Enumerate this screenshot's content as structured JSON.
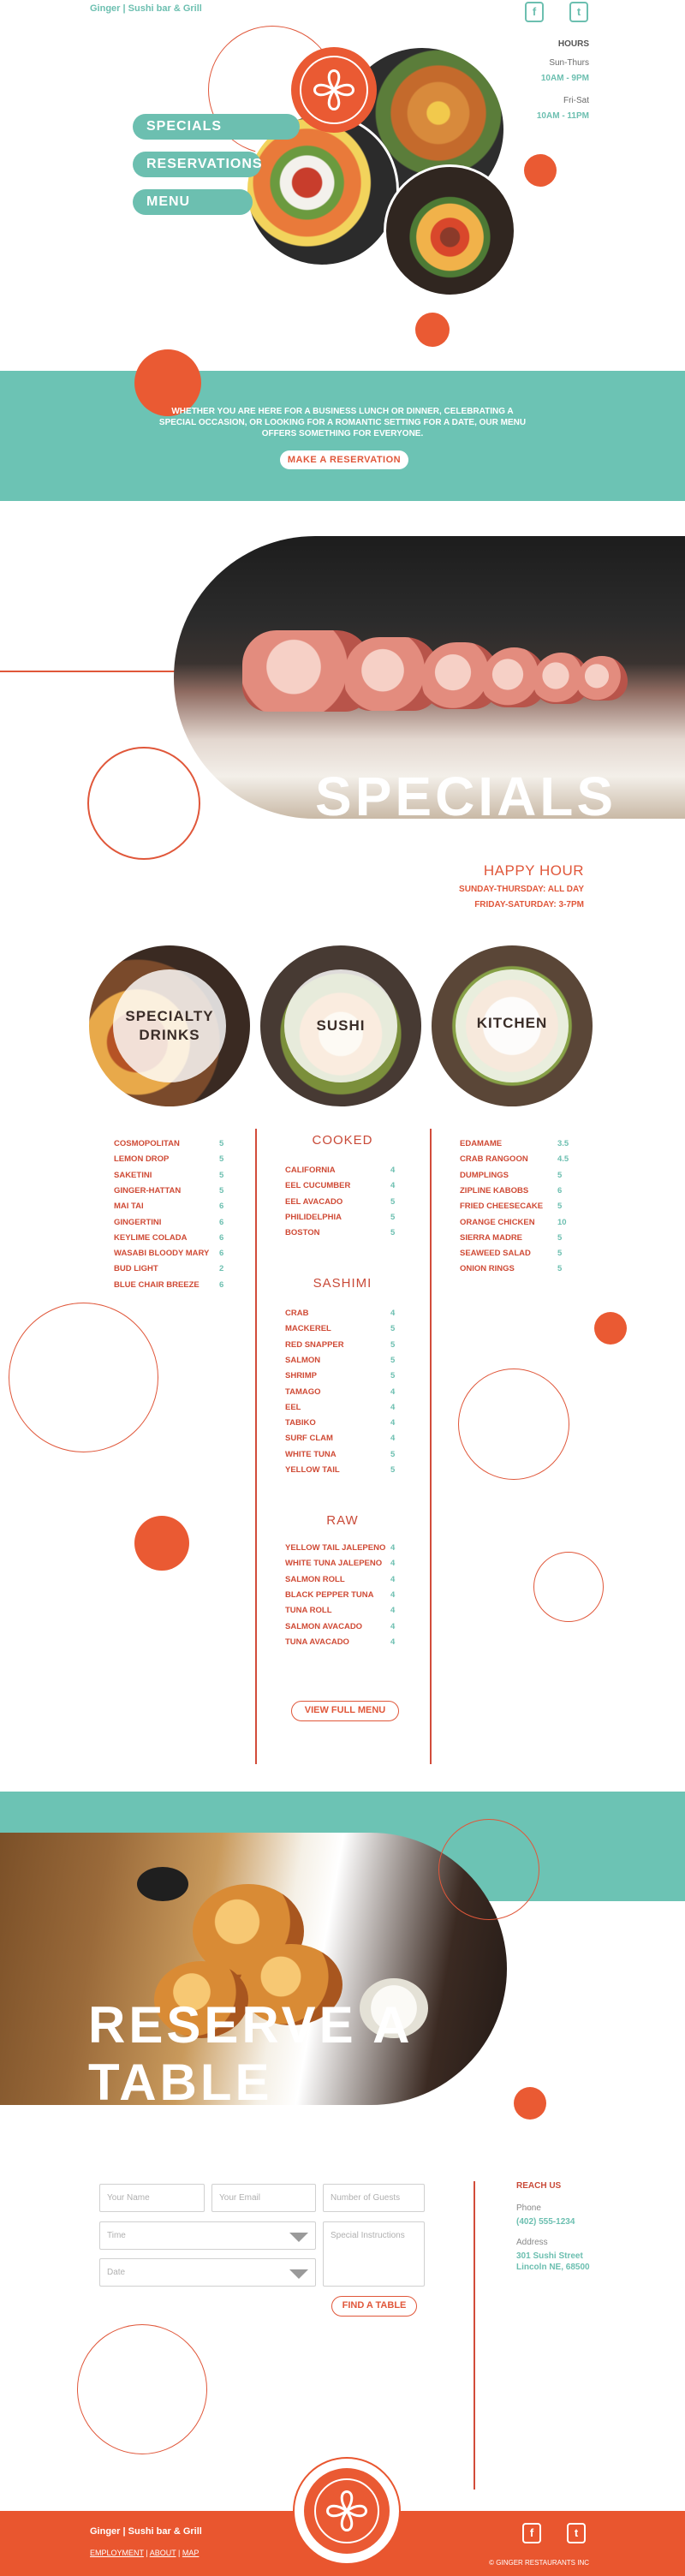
{
  "header": {
    "site_name": "Ginger | Sushi bar & Grill",
    "social": [
      {
        "icon": "facebook-icon",
        "glyph": "f"
      },
      {
        "icon": "twitter-icon",
        "glyph": "t"
      }
    ],
    "hours": {
      "title": "HOURS",
      "rows": [
        {
          "days": "Sun-Thurs",
          "time": "10AM - 9PM"
        },
        {
          "days": "Fri-Sat",
          "time": "10AM - 11PM"
        }
      ]
    }
  },
  "nav": {
    "items": [
      "SPECIALS",
      "RESERVATIONS",
      "MENU"
    ]
  },
  "intro": {
    "text": "WHETHER YOU ARE HERE FOR A BUSINESS LUNCH OR DINNER, CELEBRATING A SPECIAL OCCASION, OR LOOKING FOR A ROMANTIC SETTING FOR A DATE, OUR MENU OFFERS SOMETHING FOR EVERYONE.",
    "button": "MAKE A RESERVATION"
  },
  "specials": {
    "title": "SPECIALS",
    "happy_hour": {
      "title": "HAPPY HOUR",
      "lines": [
        "SUNDAY-THURSDAY: ALL DAY",
        "FRIDAY-SATURDAY: 3-7PM"
      ]
    }
  },
  "categories": [
    {
      "line1": "SPECIALTY",
      "line2": "DRINKS"
    },
    {
      "line1": "SUSHI",
      "line2": ""
    },
    {
      "line1": "KITCHEN",
      "line2": ""
    }
  ],
  "menu": {
    "drinks": [
      {
        "name": "COSMOPOLITAN",
        "price": "5"
      },
      {
        "name": "LEMON DROP",
        "price": "5"
      },
      {
        "name": "SAKETINI",
        "price": "5"
      },
      {
        "name": "GINGER-HATTAN",
        "price": "5"
      },
      {
        "name": "MAI TAI",
        "price": "6"
      },
      {
        "name": "GINGERTINI",
        "price": "6"
      },
      {
        "name": "KEYLIME COLADA",
        "price": "6"
      },
      {
        "name": "WASABI BLOODY MARY",
        "price": "6"
      },
      {
        "name": "BUD LIGHT",
        "price": "2"
      },
      {
        "name": "BLUE CHAIR BREEZE",
        "price": "6"
      }
    ],
    "cooked_title": "COOKED",
    "cooked": [
      {
        "name": "CALIFORNIA",
        "price": "4"
      },
      {
        "name": "EEL CUCUMBER",
        "price": "4"
      },
      {
        "name": "EEL AVACADO",
        "price": "5"
      },
      {
        "name": "PHILIDELPHIA",
        "price": "5"
      },
      {
        "name": "BOSTON",
        "price": "5"
      }
    ],
    "sashimi_title": "SASHIMI",
    "sashimi": [
      {
        "name": "CRAB",
        "price": "4"
      },
      {
        "name": "MACKEREL",
        "price": "5"
      },
      {
        "name": "RED SNAPPER",
        "price": "5"
      },
      {
        "name": "SALMON",
        "price": "5"
      },
      {
        "name": "SHRIMP",
        "price": "5"
      },
      {
        "name": "TAMAGO",
        "price": "4"
      },
      {
        "name": "EEL",
        "price": "4"
      },
      {
        "name": "TABIKO",
        "price": "4"
      },
      {
        "name": "SURF CLAM",
        "price": "4"
      },
      {
        "name": "WHITE TUNA",
        "price": "5"
      },
      {
        "name": "YELLOW TAIL",
        "price": "5"
      }
    ],
    "raw_title": "RAW",
    "raw": [
      {
        "name": "YELLOW TAIL JALEPENO",
        "price": "4"
      },
      {
        "name": "WHITE TUNA JALEPENO",
        "price": "4"
      },
      {
        "name": "SALMON ROLL",
        "price": "4"
      },
      {
        "name": "BLACK PEPPER TUNA",
        "price": "4"
      },
      {
        "name": "TUNA ROLL",
        "price": "4"
      },
      {
        "name": "SALMON AVACADO",
        "price": "4"
      },
      {
        "name": "TUNA AVACADO",
        "price": "4"
      }
    ],
    "kitchen": [
      {
        "name": "EDAMAME",
        "price": "3.5"
      },
      {
        "name": "CRAB RANGOON",
        "price": "4.5"
      },
      {
        "name": "DUMPLINGS",
        "price": "5"
      },
      {
        "name": "ZIPLINE KABOBS",
        "price": "6"
      },
      {
        "name": "FRIED CHEESECAKE",
        "price": "5"
      },
      {
        "name": "ORANGE CHICKEN",
        "price": "10"
      },
      {
        "name": "SIERRA MADRE",
        "price": "5"
      },
      {
        "name": "SEAWEED SALAD",
        "price": "5"
      },
      {
        "name": "ONION RINGS",
        "price": "5"
      }
    ],
    "view_full": "VIEW FULL MENU"
  },
  "reserve": {
    "title_line1": "RESERVE A",
    "title_line2": "TABLE",
    "form": {
      "name": "Your Name",
      "email": "Your Email",
      "guests": "Number of Guests",
      "time": "Time",
      "date": "Date",
      "instructions": "Special Instructions",
      "submit": "FIND A TABLE"
    },
    "contact": {
      "title": "REACH US",
      "phone_label": "Phone",
      "phone": "(402) 555-1234",
      "address_label": "Address",
      "address1": "301 Sushi Street",
      "address2": "Lincoln NE, 68500"
    }
  },
  "footer": {
    "site_name": "Ginger | Sushi bar & Grill",
    "links": [
      "EMPLOYMENT",
      "ABOUT",
      "MAP"
    ],
    "copyright": "© GINGER RESTAURANTS INC"
  },
  "colors": {
    "teal": "#6cc3b4",
    "orange": "#ea5a33",
    "red_text": "#cf4a35"
  }
}
